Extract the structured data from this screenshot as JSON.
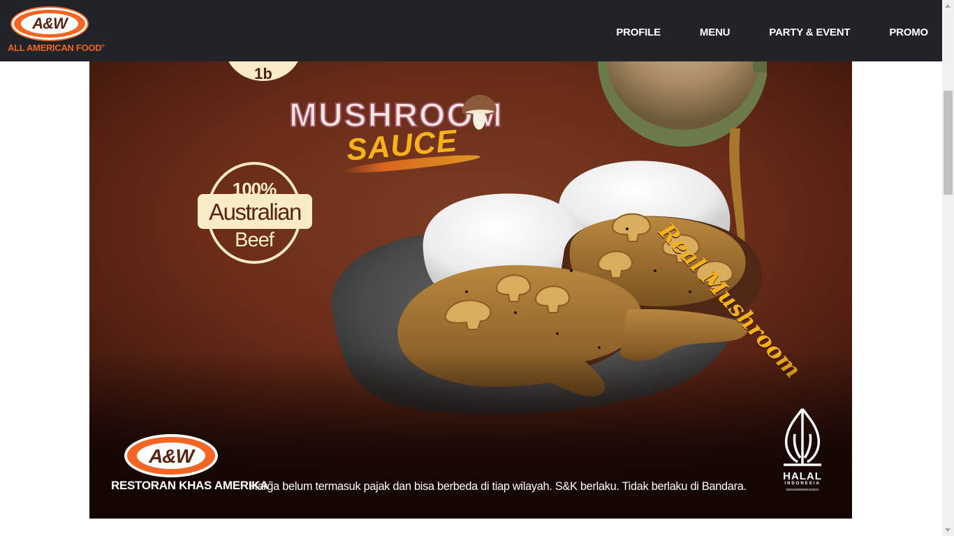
{
  "header": {
    "logo": {
      "mark": "A&W",
      "tagline": "All American Food",
      "trademark": "®"
    },
    "nav": [
      "PROFILE",
      "MENU",
      "PARTY & EVENT",
      "PROMO"
    ]
  },
  "banner": {
    "top_badge_text": "1b",
    "headline": "MUSHROOM",
    "subhead": "SAUCE",
    "beef_badge": {
      "line1": "100%",
      "line2": "Australian",
      "line3": "Beef"
    },
    "script_text": "Real Mushroom",
    "brand": {
      "mark": "A&W",
      "tagline": "Restoran Khas Amerika",
      "trademark": "™"
    },
    "disclaimer": "Harga belum termasuk pajak dan bisa berbeda di tiap wilayah. S&K berlaku. Tidak berlaku di Bandara.",
    "halal": {
      "word": "HALAL",
      "sub": "INDONESIA",
      "id": "ID00420000092340321"
    }
  },
  "colors": {
    "navbar_bg": "#202327",
    "brand_orange": "#f26522",
    "brand_brown": "#5b2410",
    "accent_yellow": "#f6b21c",
    "banner_bg": "#6a2c19",
    "cream": "#fbecc9"
  },
  "icons": [
    "mushroom-icon",
    "halal-logo-icon",
    "aw-logo-icon",
    "scroll-up-icon",
    "scroll-down-icon"
  ]
}
